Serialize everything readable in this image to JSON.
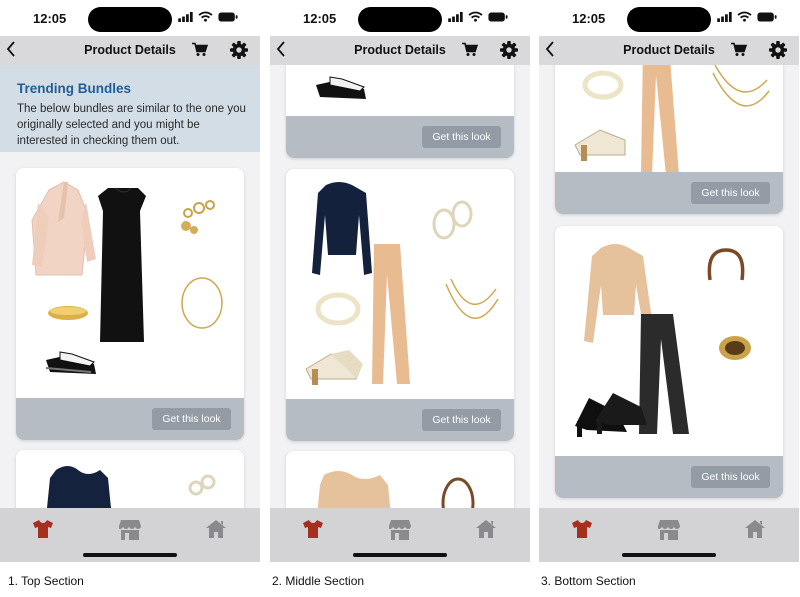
{
  "statusbar": {
    "time": "12:05"
  },
  "navbar": {
    "title": "Product Details"
  },
  "banner": {
    "title": "Trending Bundles",
    "text": "The below bundles are similar to the one you originally selected and you might be interested in checking them out."
  },
  "card": {
    "button_label": "Get this look"
  },
  "tabbar": {
    "items": [
      "shirt-icon",
      "store-icon",
      "home-icon"
    ],
    "active_color": "#a5301e",
    "inactive_color": "#8a8a8e"
  },
  "captions": [
    "1. Top Section",
    "2. Middle Section",
    "3. Bottom Section"
  ],
  "colors": {
    "banner_title": "#1f5f95",
    "card_footer": "#b5bcc4",
    "button": "#939ca5"
  }
}
